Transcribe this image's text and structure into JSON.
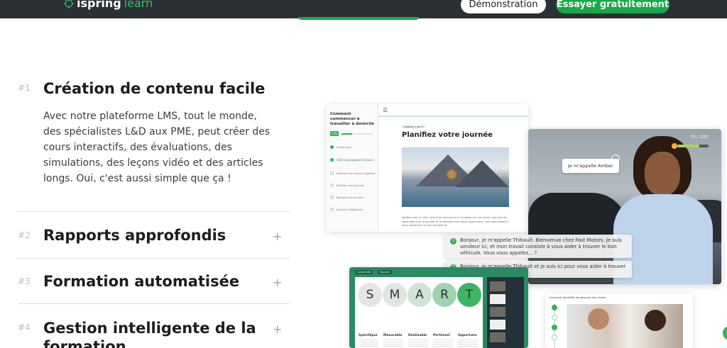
{
  "header": {
    "brand_bold": "ispring",
    "brand_light": "learn",
    "demo_button": "Démonstration",
    "try_button": "Essayer gratuitement"
  },
  "accordion": {
    "items": [
      {
        "num": "#1",
        "title": "Création de contenu facile",
        "expanded": true,
        "description": "Avec notre plateforme LMS, tout le monde, des spécialistes L&D aux PME, peut créer des cours interactifs, des évaluations, des simulations, des leçons vidéo et des articles longs. Oui, c'est aussi simple que ça !"
      },
      {
        "num": "#2",
        "title": "Rapports approfondis",
        "expanded": false,
        "toggle": "+"
      },
      {
        "num": "#3",
        "title": "Formation automatisée",
        "expanded": false,
        "toggle": "+"
      },
      {
        "num": "#4",
        "title": "Gestion intelligente de la formation",
        "expanded": false,
        "toggle": "+"
      }
    ]
  },
  "course_player": {
    "sidebar_title": "Comment commencer à travailler à domicile",
    "progress_label": "13%",
    "progress": 0.35,
    "sidebar_items": [
      "Introduction",
      "Créer votre espace de travail",
      "Maîtriser des finances digitales",
      "Planifiez votre journée",
      "Bâtissez vos réussites",
      "Évaluez le télétravail"
    ],
    "chapter_chip": "Chapitre 1 sur 5",
    "lesson_title": "Planifiez votre journée",
    "body_text": "Vérifiez avec un plan. Avant de commencer à travailler sur une tâche, discutez de votre plan pour la journée et la semaine avec votre superviseur. Cela vous aidera à vous concentrer sur les résultats et"
  },
  "roleplay": {
    "score": "70 / 100",
    "score_fraction": 0.7,
    "speech_bubble": "Je m'appelle Amber",
    "options": [
      {
        "num": "1",
        "text": "Bonjour, je m'appelle Thibault. Bienvenue chez Fast Motors. Je suis vendeur ici, et mon travail consiste à vous aider à trouver le bon véhicule. Vous vous appelez... ?"
      },
      {
        "num": "2",
        "text": "Bonjour, je m'appelle Thibault et je suis ici pour vous aider à trouver la voiture qu'il vous faut."
      }
    ]
  },
  "smart_slide": {
    "tabs": [
      "Conformité",
      "Rapport"
    ],
    "letters": [
      "S",
      "M",
      "A",
      "R",
      "T"
    ],
    "labels": [
      "Spécifique",
      "Mesurable",
      "Réalisable",
      "Pertinent",
      "Opportuns"
    ],
    "colors": [
      "#e5e5e5",
      "#dfe6e1",
      "#cfe3d6",
      "#9fd2af",
      "#3fb466"
    ]
  },
  "communication": {
    "header": "Comment identifier les besoins des clients"
  },
  "colors": {
    "topbar": "#2b3035",
    "accent_green": "#17a84a",
    "demo_bg": "#ffffff"
  }
}
